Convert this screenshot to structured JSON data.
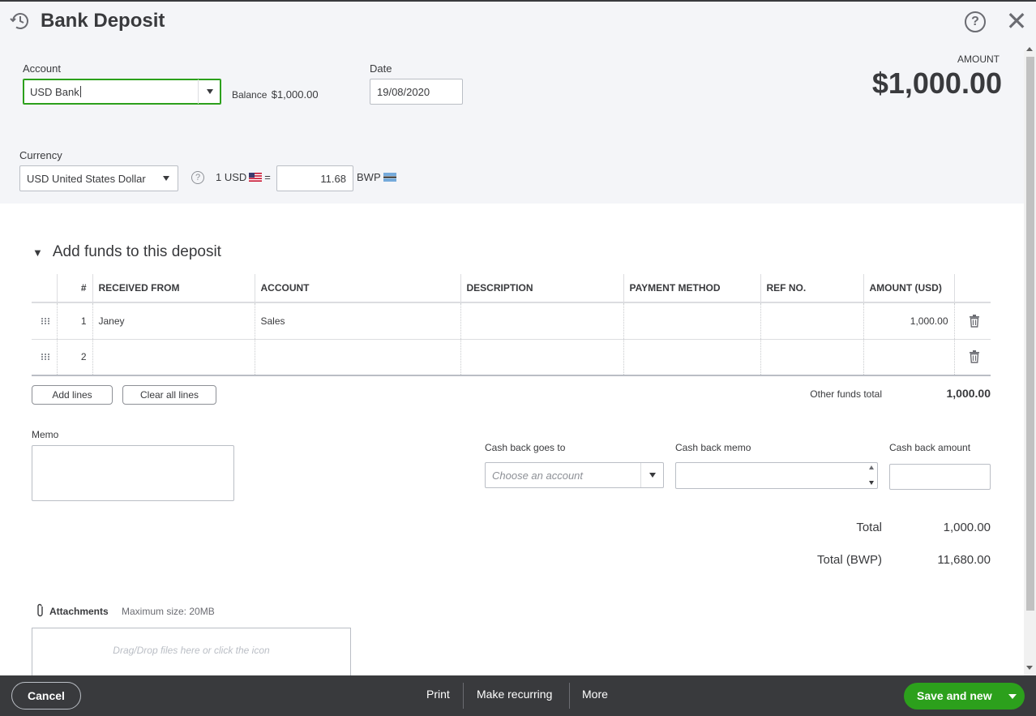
{
  "header": {
    "title": "Bank Deposit",
    "amount_label": "AMOUNT",
    "amount_value": "$1,000.00"
  },
  "account": {
    "label": "Account",
    "value": "USD Bank",
    "balance_label": "Balance",
    "balance_value": "$1,000.00"
  },
  "date": {
    "label": "Date",
    "value": "19/08/2020"
  },
  "currency": {
    "label": "Currency",
    "value": "USD United States Dollar",
    "rate_prefix": "1 USD",
    "rate_equals": "=",
    "rate_value": "11.68",
    "rate_suffix": "BWP"
  },
  "funds": {
    "section_title": "Add funds to this deposit",
    "columns": [
      "#",
      "RECEIVED FROM",
      "ACCOUNT",
      "DESCRIPTION",
      "PAYMENT METHOD",
      "REF NO.",
      "AMOUNT (USD)"
    ],
    "rows": [
      {
        "num": "1",
        "received_from": "Janey",
        "account": "Sales",
        "description": "",
        "payment_method": "",
        "ref_no": "",
        "amount": "1,000.00"
      },
      {
        "num": "2",
        "received_from": "",
        "account": "",
        "description": "",
        "payment_method": "",
        "ref_no": "",
        "amount": ""
      }
    ],
    "add_lines_label": "Add lines",
    "clear_lines_label": "Clear all lines",
    "other_funds_total_label": "Other funds total",
    "other_funds_total_value": "1,000.00"
  },
  "memo": {
    "label": "Memo",
    "value": ""
  },
  "cashback": {
    "goes_to_label": "Cash back goes to",
    "goes_to_placeholder": "Choose an account",
    "memo_label": "Cash back memo",
    "amount_label": "Cash back amount"
  },
  "totals": {
    "total_label": "Total",
    "total_value": "1,000.00",
    "total_bwp_label": "Total (BWP)",
    "total_bwp_value": "11,680.00"
  },
  "attachments": {
    "label": "Attachments",
    "max_size": "Maximum size: 20MB",
    "dropzone_text": "Drag/Drop files here or click the icon"
  },
  "footer": {
    "cancel_label": "Cancel",
    "print_label": "Print",
    "recurring_label": "Make recurring",
    "more_label": "More",
    "save_label": "Save and new"
  },
  "colors": {
    "accent_green": "#2ca01c",
    "footer_bg": "#393a3d",
    "header_bg": "#f4f5f8"
  }
}
